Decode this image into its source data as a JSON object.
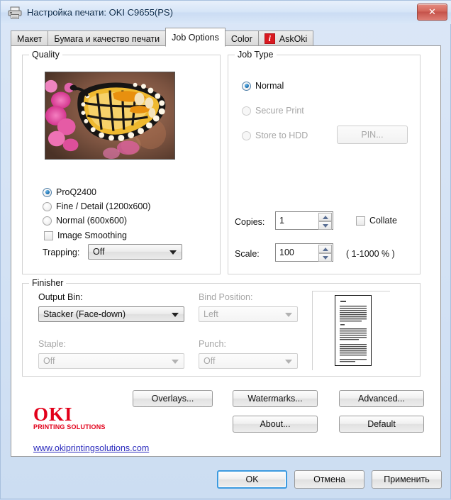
{
  "window": {
    "title": "Настройка печати: OKI C9655(PS)",
    "icon": "printer-icon",
    "close_label": "✕"
  },
  "tabs": [
    {
      "label": "Макет",
      "active": false,
      "icon": null
    },
    {
      "label": "Бумага и качество печати",
      "active": false,
      "icon": null
    },
    {
      "label": "Job Options",
      "active": true,
      "icon": null
    },
    {
      "label": "Color",
      "active": false,
      "icon": null
    },
    {
      "label": "AskOki",
      "active": false,
      "icon": "info-badge-icon",
      "icon_glyph": "i"
    }
  ],
  "quality": {
    "legend": "Quality",
    "preview_alt": "butterfly-preview-image",
    "options": [
      {
        "label": "ProQ2400",
        "checked": true,
        "disabled": false
      },
      {
        "label": "Fine / Detail (1200x600)",
        "checked": false,
        "disabled": false
      },
      {
        "label": "Normal (600x600)",
        "checked": false,
        "disabled": false
      }
    ],
    "image_smoothing": {
      "label": "Image Smoothing",
      "checked": false
    },
    "trapping": {
      "label": "Trapping:",
      "value": "Off",
      "disabled": false
    }
  },
  "job_type": {
    "legend": "Job Type",
    "options": [
      {
        "label": "Normal",
        "checked": true,
        "disabled": false
      },
      {
        "label": "Secure Print",
        "checked": false,
        "disabled": true
      },
      {
        "label": "Store to HDD",
        "checked": false,
        "disabled": true
      }
    ],
    "pin_button": {
      "label": "PIN...",
      "disabled": true
    },
    "copies": {
      "label": "Copies:",
      "value": "1"
    },
    "collate": {
      "label": "Collate",
      "checked": false
    },
    "scale": {
      "label": "Scale:",
      "value": "100",
      "hint": "( 1-1000 % )"
    }
  },
  "finisher": {
    "legend": "Finisher",
    "output_bin": {
      "label": "Output Bin:",
      "value": "Stacker (Face-down)",
      "disabled": false
    },
    "bind_position": {
      "label": "Bind Position:",
      "value": "Left",
      "disabled": true
    },
    "staple": {
      "label": "Staple:",
      "value": "Off",
      "disabled": true
    },
    "punch": {
      "label": "Punch:",
      "value": "Off",
      "disabled": true
    },
    "preview_alt": "page-layout-preview"
  },
  "action_buttons": {
    "overlays": "Overlays...",
    "watermarks": "Watermarks...",
    "advanced": "Advanced...",
    "about": "About...",
    "default": "Default"
  },
  "branding": {
    "logo_word": "OKI",
    "logo_tagline": "PRINTING SOLUTIONS",
    "link": "www.okiprintingsolutions.com",
    "logo_color": "#e2001a"
  },
  "dialog_buttons": {
    "ok": "OK",
    "cancel": "Отмена",
    "apply": "Применить"
  },
  "colors": {
    "titlebar": "#d6e5f7",
    "accent_focus": "#3c9adf",
    "close_red": "#c5524a",
    "askoki_red": "#d81920",
    "link_blue": "#2b2bbd"
  }
}
